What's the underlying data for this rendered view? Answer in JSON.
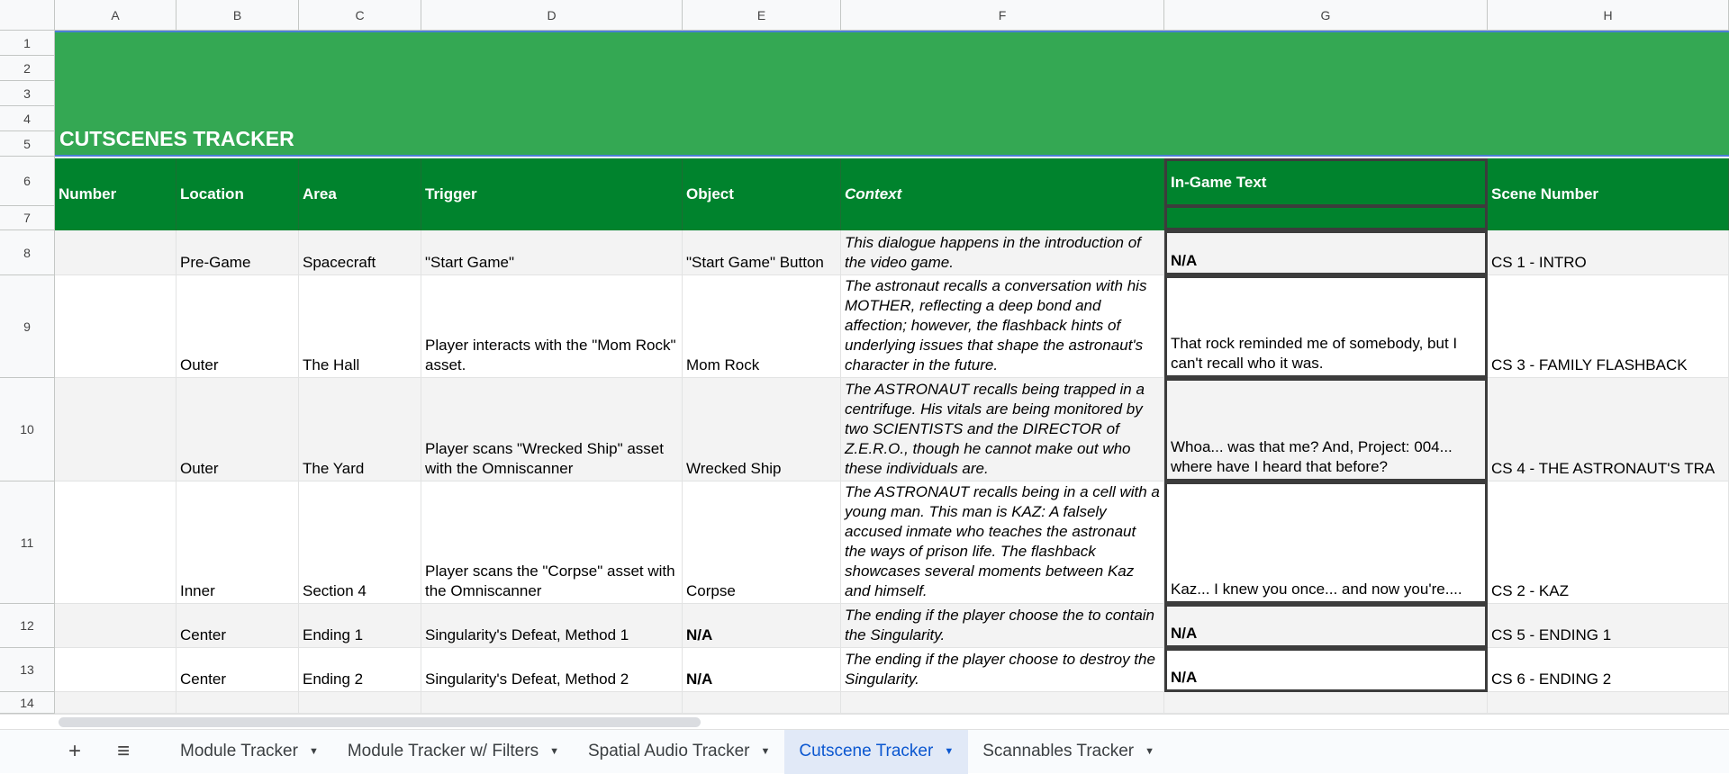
{
  "columns": [
    "A",
    "B",
    "C",
    "D",
    "E",
    "F",
    "G",
    "H"
  ],
  "rows": [
    "1",
    "2",
    "3",
    "4",
    "5",
    "6",
    "7",
    "8",
    "9",
    "10",
    "11",
    "12",
    "13",
    "14"
  ],
  "title": "CUTSCENES TRACKER",
  "headers": [
    "Number",
    "Location",
    "Area",
    "Trigger",
    "Object",
    "Context",
    "In-Game Text",
    "Scene Number"
  ],
  "data": [
    [
      "",
      "Pre-Game",
      "Spacecraft",
      "\"Start Game\"",
      "\"Start Game\" Button",
      "This dialogue happens in the introduction of the video game.",
      "N/A",
      "CS 1 - INTRO"
    ],
    [
      "",
      "Outer",
      "The Hall",
      "Player interacts with the \"Mom Rock\" asset.",
      "Mom Rock",
      "The astronaut recalls a conversation with his MOTHER, reflecting a deep bond and affection; however, the flashback hints of underlying issues that shape the astronaut's character in the future.",
      "That rock reminded me of somebody, but I can't recall who it was.",
      "CS 3 - FAMILY FLASHBACK"
    ],
    [
      "",
      "Outer",
      "The Yard",
      "Player scans \"Wrecked Ship\" asset with the Omniscanner",
      "Wrecked Ship",
      "The ASTRONAUT recalls being trapped in a centrifuge. His vitals are being monitored by two SCIENTISTS and the DIRECTOR of Z.E.R.O., though he cannot make out who these individuals are.",
      "Whoa... was that me? And, Project: 004... where have I heard that before?",
      "CS 4 - THE ASTRONAUT'S TRA"
    ],
    [
      "",
      "Inner",
      "Section 4",
      "Player scans the \"Corpse\" asset with the Omniscanner",
      "Corpse",
      "The ASTRONAUT recalls being in a cell with a young man. This man is KAZ: A falsely accused inmate who teaches the astronaut the ways of prison life. The flashback showcases several moments between Kaz and himself.",
      "Kaz... I knew you once... and now you're....",
      "CS 2 - KAZ"
    ],
    [
      "",
      "Center",
      "Ending 1",
      "Singularity's Defeat, Method 1",
      "N/A",
      "The ending if the player choose the to contain the Singularity.",
      "N/A",
      "CS 5 - ENDING 1"
    ],
    [
      "",
      "Center",
      "Ending 2",
      "Singularity's Defeat, Method 2",
      "N/A",
      "The ending if the player choose to destroy the Singularity.",
      "N/A",
      "CS 6 - ENDING 2"
    ]
  ],
  "tabs": [
    {
      "label": "Module Tracker",
      "active": false
    },
    {
      "label": "Module Tracker w/ Filters",
      "active": false
    },
    {
      "label": "Spatial Audio Tracker",
      "active": false
    },
    {
      "label": "Cutscene Tracker",
      "active": true
    },
    {
      "label": "Scannables Tracker",
      "active": false
    }
  ],
  "icons": {
    "add": "plus-icon",
    "all_sheets": "menu-icon",
    "tab_menu": "caret-down-icon"
  },
  "colors": {
    "banner": "#34a853",
    "header": "#00832d",
    "active_tab": "#0b57d0"
  }
}
